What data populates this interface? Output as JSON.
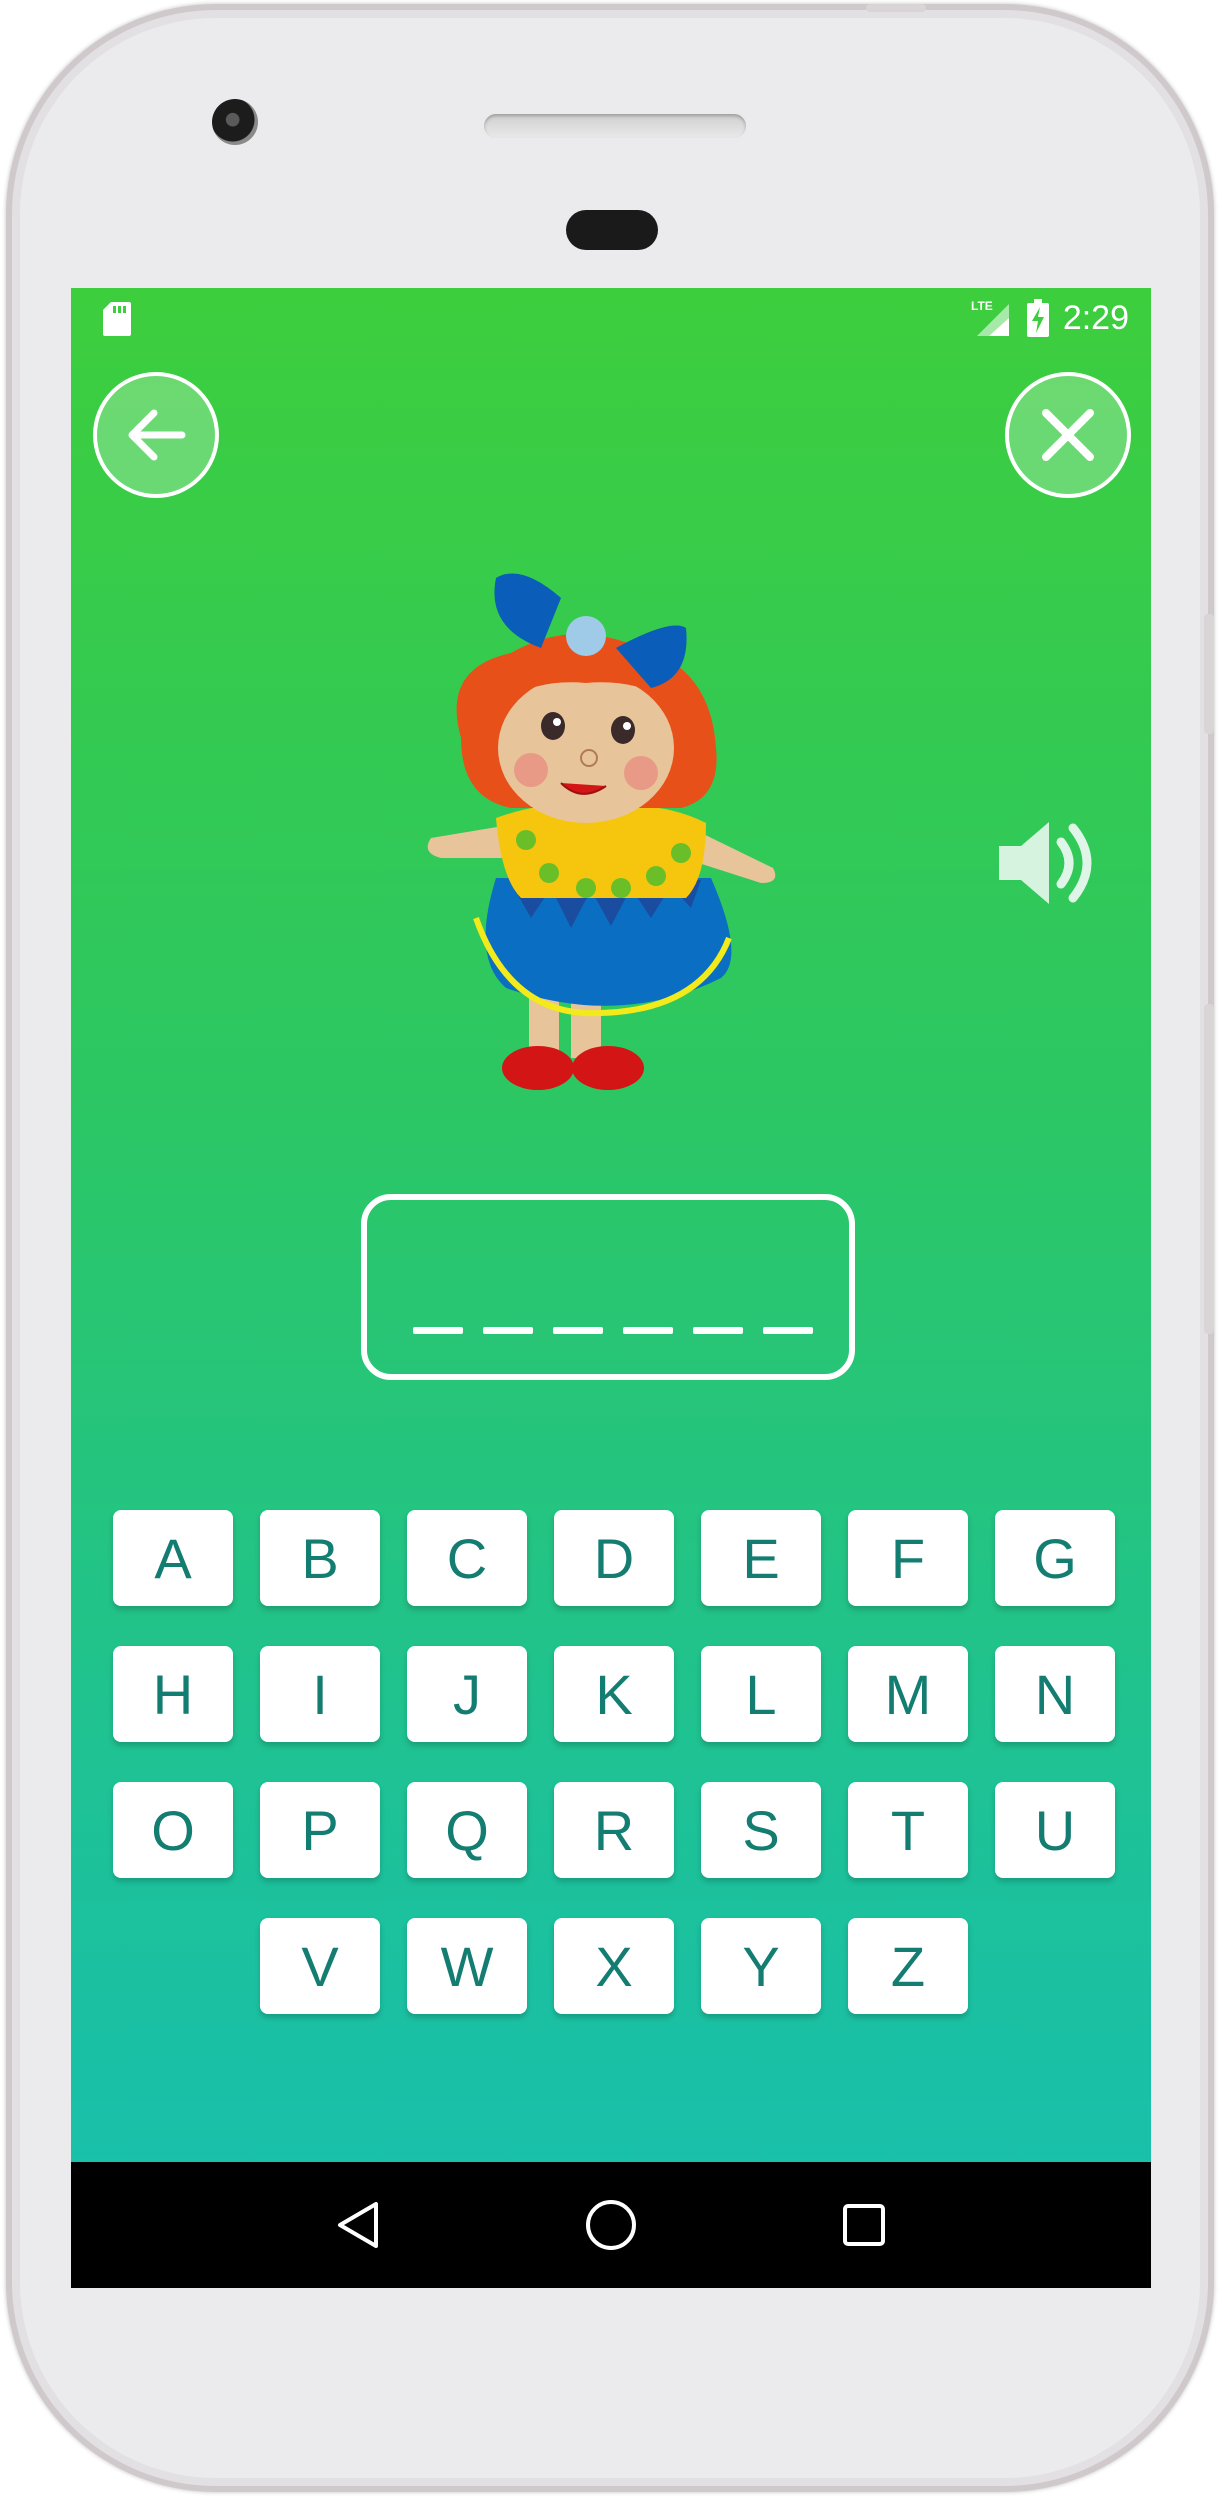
{
  "status_bar": {
    "time": "2:29",
    "network": "LTE",
    "icons": [
      "sd-card-icon",
      "lte-signal-icon",
      "battery-charging-icon"
    ]
  },
  "header": {
    "back_icon": "arrow-left-icon",
    "close_icon": "close-icon"
  },
  "puzzle": {
    "image": "doll",
    "sound_icon": "speaker-icon",
    "answer_slots": [
      "_",
      "_",
      "_",
      "_",
      "_",
      "_"
    ]
  },
  "keyboard": {
    "rows": [
      [
        "A",
        "B",
        "C",
        "D",
        "E",
        "F",
        "G"
      ],
      [
        "H",
        "I",
        "J",
        "K",
        "L",
        "M",
        "N"
      ],
      [
        "O",
        "P",
        "Q",
        "R",
        "S",
        "T",
        "U"
      ],
      [
        "V",
        "W",
        "X",
        "Y",
        "Z"
      ]
    ]
  },
  "nav_bar": {
    "icons": [
      "back-triangle-icon",
      "home-circle-icon",
      "recents-square-icon"
    ]
  },
  "colors": {
    "gradient_top": "#3dce3d",
    "gradient_bottom": "#18bfb0",
    "key_text": "#147d72"
  }
}
